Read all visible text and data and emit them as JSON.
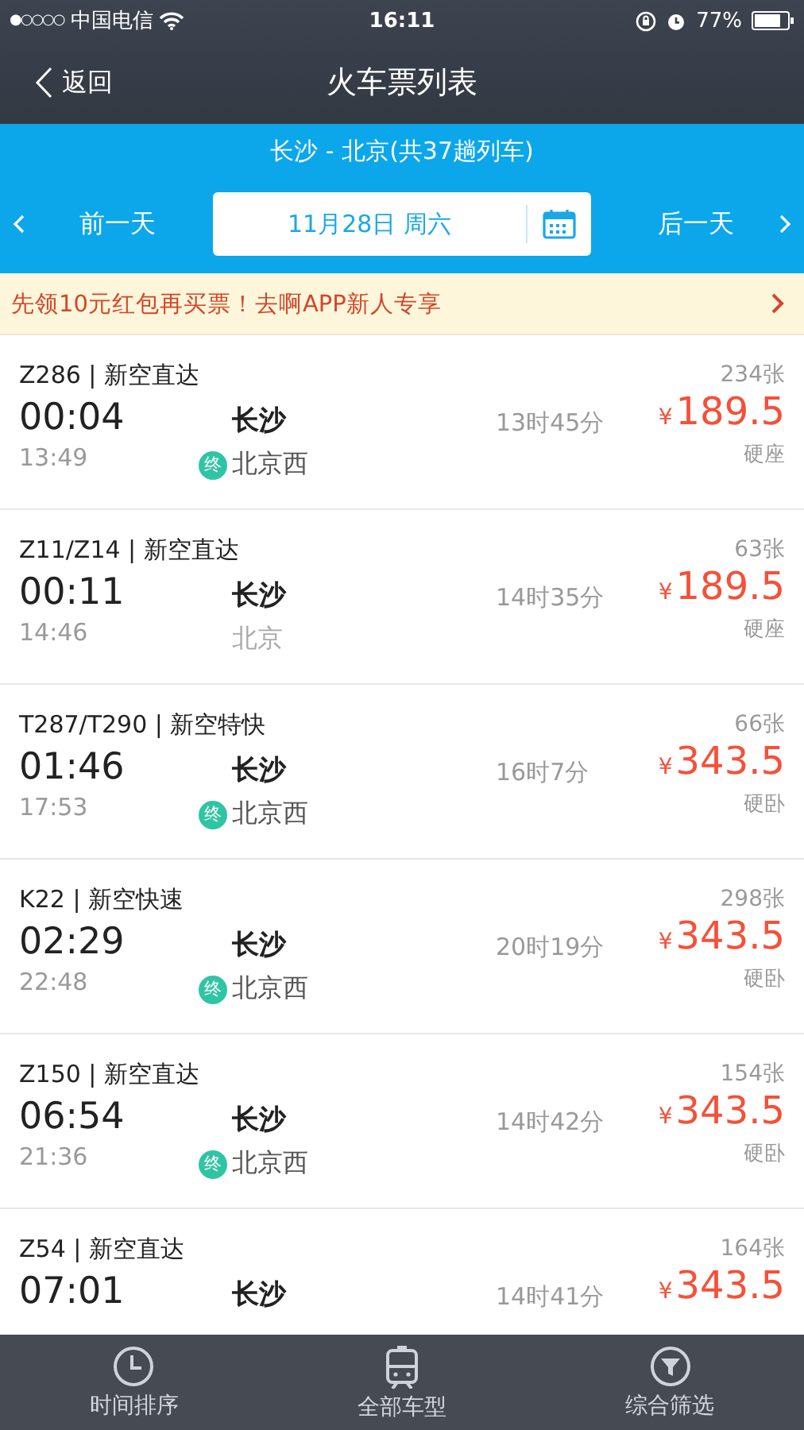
{
  "status_bar": {
    "signal": "●○○○○",
    "carrier": "中国电信",
    "time": "16:11",
    "battery": "77%"
  },
  "nav": {
    "back": "返回",
    "title": "火车票列表"
  },
  "route": {
    "summary": "长沙 - 北京(共37趟列车)",
    "prev_day": "前一天",
    "date": "11月28日  周六",
    "next_day": "后一天"
  },
  "promo": {
    "text": "先领10元红包再买票！去啊APP新人专享"
  },
  "trains": [
    {
      "name": "Z286 | 新空直达",
      "depart_time": "00:04",
      "arrive_time": "13:49",
      "from": "长沙",
      "to": "北京西",
      "end_badge": "终",
      "duration": "13时45分",
      "tickets": "234张",
      "price": "189.5",
      "currency": "¥",
      "seat": "硬座"
    },
    {
      "name": "Z11/Z14 | 新空直达",
      "depart_time": "00:11",
      "arrive_time": "14:46",
      "from": "长沙",
      "to": "北京",
      "duration": "14时35分",
      "tickets": "63张",
      "price": "189.5",
      "currency": "¥",
      "seat": "硬座"
    },
    {
      "name": "T287/T290 | 新空特快",
      "depart_time": "01:46",
      "arrive_time": "17:53",
      "from": "长沙",
      "to": "北京西",
      "end_badge": "终",
      "duration": "16时7分",
      "tickets": "66张",
      "price": "343.5",
      "currency": "¥",
      "seat": "硬卧"
    },
    {
      "name": "K22 | 新空快速",
      "depart_time": "02:29",
      "arrive_time": "22:48",
      "from": "长沙",
      "to": "北京西",
      "end_badge": "终",
      "duration": "20时19分",
      "tickets": "298张",
      "price": "343.5",
      "currency": "¥",
      "seat": "硬卧"
    },
    {
      "name": "Z150 | 新空直达",
      "depart_time": "06:54",
      "arrive_time": "21:36",
      "from": "长沙",
      "to": "北京西",
      "end_badge": "终",
      "duration": "14时42分",
      "tickets": "154张",
      "price": "343.5",
      "currency": "¥",
      "seat": "硬卧"
    },
    {
      "name": "Z54 | 新空直达",
      "depart_time": "07:01",
      "from": "长沙",
      "duration": "14时41分",
      "tickets": "164张",
      "price": "343.5",
      "currency": "¥"
    }
  ],
  "bottom_tabs": [
    {
      "label": "时间排序",
      "kind": "clock"
    },
    {
      "label": "全部车型",
      "kind": "train"
    },
    {
      "label": "综合筛选",
      "kind": "filter"
    }
  ]
}
